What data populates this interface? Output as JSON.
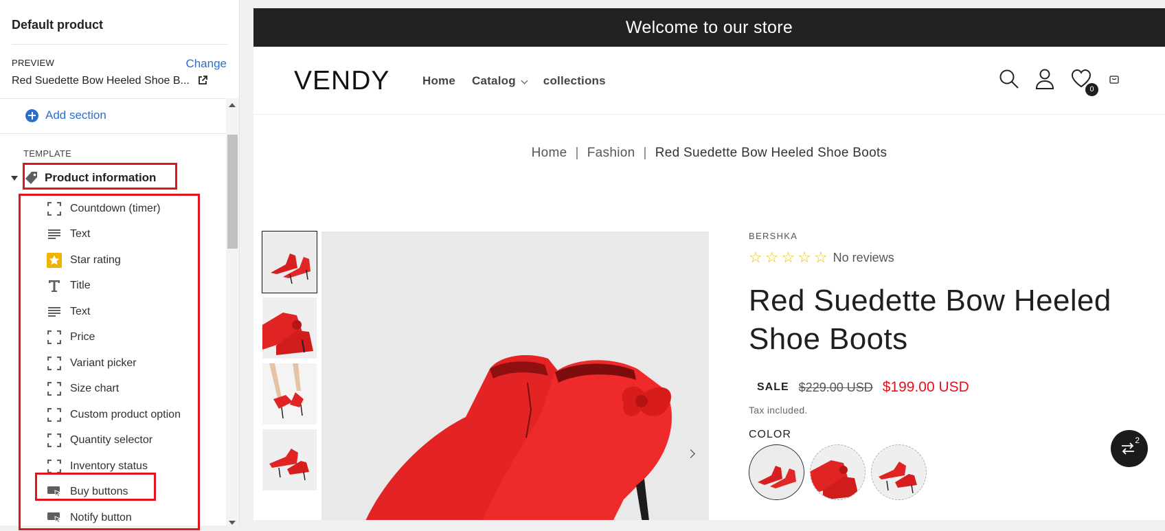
{
  "sidebar": {
    "title": "Default product",
    "preview_label": "PREVIEW",
    "change_label": "Change",
    "preview_product": "Red Suedette Bow Heeled Shoe B...",
    "add_section_label": "Add section",
    "template_label": "TEMPLATE",
    "section_label": "Product information",
    "blocks": [
      {
        "label": "Countdown (timer)",
        "icon": "dashed-square-icon"
      },
      {
        "label": "Text",
        "icon": "text-lines-icon"
      },
      {
        "label": "Star rating",
        "icon": "star-icon"
      },
      {
        "label": "Title",
        "icon": "title-t-icon"
      },
      {
        "label": "Text",
        "icon": "text-lines-icon"
      },
      {
        "label": "Price",
        "icon": "dashed-square-icon"
      },
      {
        "label": "Variant picker",
        "icon": "dashed-square-icon"
      },
      {
        "label": "Size chart",
        "icon": "dashed-square-icon"
      },
      {
        "label": "Custom product option",
        "icon": "dashed-square-icon"
      },
      {
        "label": "Quantity selector",
        "icon": "dashed-square-icon"
      },
      {
        "label": "Inventory status",
        "icon": "dashed-square-icon"
      },
      {
        "label": "Buy buttons",
        "icon": "button-cursor-icon"
      },
      {
        "label": "Notify button",
        "icon": "button-cursor-icon"
      }
    ],
    "highlight_color": "#e1141e"
  },
  "store": {
    "announcement": "Welcome to our store",
    "logo": "VENDY",
    "nav": {
      "home": "Home",
      "catalog": "Catalog",
      "collections": "collections"
    },
    "wishlist_count": "0",
    "breadcrumb": {
      "home": "Home",
      "category": "Fashion",
      "current": "Red Suedette Bow Heeled Shoe Boots"
    },
    "product": {
      "vendor": "BERSHKA",
      "rating_text": "No reviews",
      "title": "Red Suedette Bow Heeled Shoe Boots",
      "sale_label": "SALE",
      "compare_price": "$229.00 USD",
      "price": "$199.00 USD",
      "tax_note": "Tax included.",
      "option_label": "COLOR"
    },
    "floating_button_count": "2",
    "colors": {
      "announcement_bg": "#222222",
      "sale_price": "#e3101d",
      "star": "#e9c00f",
      "link": "#2c6ecb"
    }
  }
}
